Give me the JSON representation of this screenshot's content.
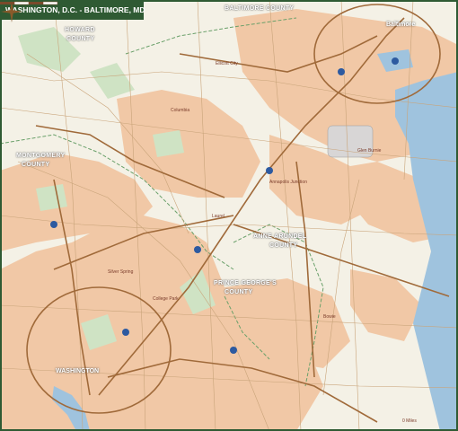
{
  "map": {
    "title": "WASHINGTON, D.C. - BALTIMORE, MD",
    "regions": {
      "baltimore_county": "BALTIMORE COUNTY",
      "howard_county_1": "HOWARD",
      "howard_county_2": "COUNTY",
      "montgomery_county_1": "MONTGOMERY",
      "montgomery_county_2": "COUNTY",
      "anne_arundel_1": "ANNE ARUNDEL",
      "anne_arundel_2": "COUNTY",
      "prince_georges_1": "PRINCE GEORGE'S",
      "prince_georges_2": "COUNTY"
    },
    "cities": {
      "baltimore": "Baltimore",
      "washington": "WASHINGTON",
      "columbia": "Columbia",
      "ellicott_city": "Ellicott City",
      "glen_burnie": "Glen Burnie",
      "bowie": "Bowie",
      "laurel": "Laurel",
      "silver_spring": "Silver Spring",
      "college_park": "College Park",
      "annapolis_junction": "Annapolis Junction"
    },
    "scale_label": "0 Miles",
    "colors": {
      "urban": "#f1c8a6",
      "rural": "#f4f1e6",
      "park": "#cfe3c4",
      "water": "#9fc3de",
      "road": "#b48a5c",
      "highway": "#a06a3a",
      "border": "#2f5a33"
    }
  }
}
